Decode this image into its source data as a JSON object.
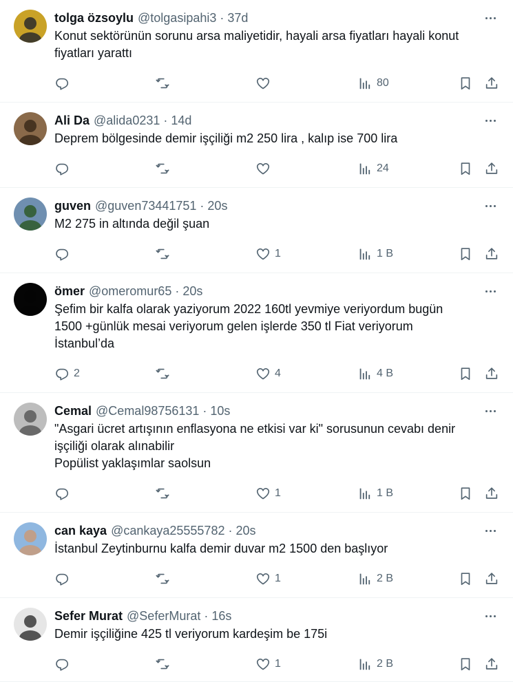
{
  "tweets": [
    {
      "name": "tolga özsoylu",
      "handle": "@tolgasipahi3",
      "time": "37d",
      "text": "Konut sektörünün sorunu arsa maliyetidir, hayali arsa fiyatları hayali konut\nfiyatları yarattı",
      "replies": "",
      "retweets": "",
      "likes": "",
      "views": "80",
      "avatar_bg": "#c9a227",
      "avatar_fg": "#2b2b2b"
    },
    {
      "name": "Ali Da",
      "handle": "@alida0231",
      "time": "14d",
      "text": "Deprem bölgesinde demir işçiliği m2 250 lira , kalıp ise 700 lira",
      "replies": "",
      "retweets": "",
      "likes": "",
      "views": "24",
      "avatar_bg": "#8a6a4a",
      "avatar_fg": "#3b2a1a"
    },
    {
      "name": "guven",
      "handle": "@guven73441751",
      "time": "20s",
      "text": "M2 275 in altında değil şuan",
      "replies": "",
      "retweets": "",
      "likes": "1",
      "views": "1 B",
      "avatar_bg": "#6f8fb0",
      "avatar_fg": "#2f5a2a"
    },
    {
      "name": "ömer",
      "handle": "@omeromur65",
      "time": "20s",
      "text": "Şefim bir kalfa olarak yaziyorum 2022 160tl yevmiye veriyordum bugün\n1500 +günlük mesai veriyorum gelen işlerde 350 tl Fiat veriyorum\nİstanbul’da",
      "replies": "2",
      "retweets": "",
      "likes": "4",
      "views": "4 B",
      "avatar_bg": "#050505",
      "avatar_fg": "#050505"
    },
    {
      "name": "Cemal",
      "handle": "@Cemal98756131",
      "time": "10s",
      "text": "\"Asgari ücret artışının enflasyona ne etkisi var ki\" sorusunun cevabı denir\nişçiliği olarak alınabilir\nPopülist yaklaşımlar saolsun",
      "replies": "",
      "retweets": "",
      "likes": "1",
      "views": "1 B",
      "avatar_bg": "#bdbdbd",
      "avatar_fg": "#5a5a5a"
    },
    {
      "name": "can kaya",
      "handle": "@cankaya25555782",
      "time": "20s",
      "text": "İstanbul Zeytinburnu kalfa demir duvar m2 1500 den başlıyor",
      "replies": "",
      "retweets": "",
      "likes": "1",
      "views": "2 B",
      "avatar_bg": "#8fb7e0",
      "avatar_fg": "#c99b7a"
    },
    {
      "name": "Sefer Murat",
      "handle": "@SeferMurat",
      "time": "16s",
      "text": "Demir işçiliğine 425 tl veriyorum kardeşim be 175i",
      "replies": "",
      "retweets": "",
      "likes": "1",
      "views": "2 B",
      "avatar_bg": "#e6e6e6",
      "avatar_fg": "#3a3a3a"
    }
  ],
  "colors": {
    "text": "#0f1419",
    "muted": "#536471",
    "divider": "#eff3f4"
  }
}
